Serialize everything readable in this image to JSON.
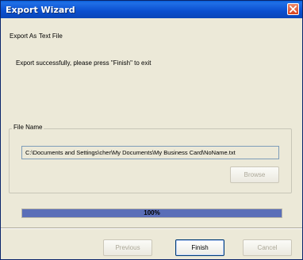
{
  "window": {
    "title": "Export Wizard",
    "close_icon": "close-icon"
  },
  "export_as": {
    "label": "Export As",
    "value": "Text File"
  },
  "status_message": "Export successfully, please press \"Finish\" to exit",
  "file_name_group": {
    "label": "File Name",
    "path": "C:\\Documents and Settings\\cher\\My Documents\\My Business Card\\NoName.txt",
    "browse_label": "Browse"
  },
  "progress": {
    "percent": 100,
    "label": "100%",
    "fill_color": "#5a6eb8"
  },
  "buttons": {
    "previous_label": "Previous",
    "finish_label": "Finish",
    "cancel_label": "Cancel"
  }
}
